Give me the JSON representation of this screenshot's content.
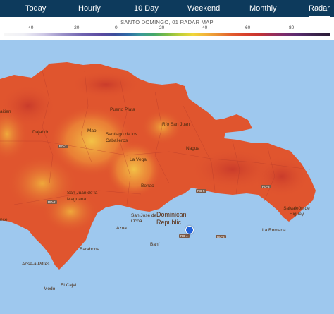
{
  "nav": {
    "tabs": [
      {
        "label": "Today",
        "active": false
      },
      {
        "label": "Hourly",
        "active": false
      },
      {
        "label": "10 Day",
        "active": false
      },
      {
        "label": "Weekend",
        "active": false
      },
      {
        "label": "Monthly",
        "active": false
      },
      {
        "label": "Radar",
        "active": true
      }
    ]
  },
  "legend": {
    "title": "SANTO DOMINGO, 01 RADAR MAP",
    "ticks": [
      "-40",
      "-20",
      "0",
      "20",
      "40",
      "60",
      "80"
    ]
  },
  "map": {
    "places": {
      "haiti": "aitien",
      "puerto_plata": "Puerto Plata",
      "dajabon": "Dajabón",
      "mao": "Mao",
      "santiago": "Santiago de los Caballeros",
      "rio_san_juan": "Río San Juan",
      "nagua": "Nagua",
      "la_vega": "La Vega",
      "bonao": "Bonao",
      "san_juan": "San Juan de la Maguana",
      "san_jose": "San José de Ocoa",
      "azua": "Azua",
      "bani": "Baní",
      "barahona": "Barahona",
      "anse": "Anse-à-Pitres",
      "el_cajal": "El Cajal",
      "modo": "Modo",
      "dominican_republic": "Dominican Republic",
      "la_romana": "La Romana",
      "salvaleon": "Salvaleón de Higüey",
      "ance": "nce"
    },
    "roads": {
      "r1": "RD-1",
      "r2": "RD-5",
      "r3": "RD-3",
      "r4": "RD-3",
      "r5": "RD-4",
      "r6": "RD-2"
    },
    "colors": {
      "ocean": "#9ec8ee",
      "land_base": "#e0552e",
      "land_dark": "#c93c2a",
      "land_warm": "#ee7a32",
      "land_yellow": "#f2b83e",
      "location": "#1f5fd8"
    }
  }
}
